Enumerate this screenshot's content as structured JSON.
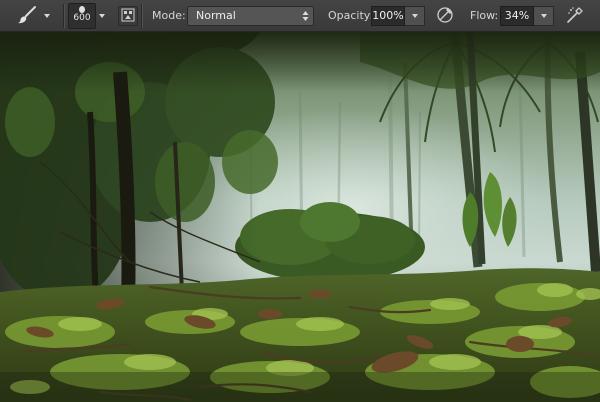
{
  "toolbar": {
    "tool_preset_icon": "brush-icon",
    "brush_size": "600",
    "mode_label": "Mode:",
    "mode_value": "Normal",
    "opacity_label": "Opacity:",
    "opacity_value": "100%",
    "flow_label": "Flow:",
    "flow_value": "34%",
    "icons": {
      "brush_panel": "brush-panel-icon",
      "pressure_opacity": "pressure-opacity-icon",
      "airbrush": "airbrush-icon"
    }
  },
  "canvas": {
    "subject": "photo",
    "palette": {
      "moss": "#6c8a2e",
      "moss_light": "#9cbc4a",
      "mist": "#c9d8cf",
      "canopy": "#2e4219",
      "trunk": "#2a2517"
    }
  }
}
